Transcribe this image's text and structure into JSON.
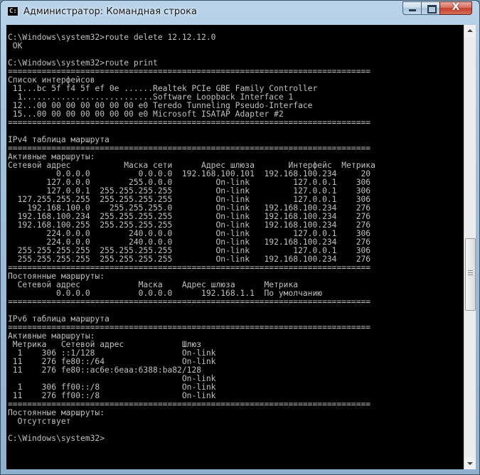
{
  "window": {
    "title": "Администратор: Командная строка",
    "icon_label": "C:\\",
    "close_symbol": "X"
  },
  "console": {
    "lines": [
      "C:\\Windows\\system32>route delete 12.12.12.0",
      " OK",
      "",
      "C:\\Windows\\system32>route print",
      "===========================================================================",
      "Список интерфейсов",
      " 11...bc 5f f4 5f ef 0e ......Realtek PCIe GBE Family Controller",
      "  1...........................Software Loopback Interface 1",
      " 12...00 00 00 00 00 00 00 e0 Teredo Tunneling Pseudo-Interface",
      " 15...00 00 00 00 00 00 00 e0 Microsoft ISATAP Adapter #2",
      "===========================================================================",
      "",
      "IPv4 таблица маршрута",
      "===========================================================================",
      "Активные маршруты:",
      "Сетевой адрес           Маска сети      Адрес шлюза       Интерфейс  Метрика",
      "          0.0.0.0          0.0.0.0  192.168.100.101  192.168.100.234     20",
      "        127.0.0.0        255.0.0.0         On-link         127.0.0.1    306",
      "        127.0.0.1  255.255.255.255         On-link         127.0.0.1    306",
      "  127.255.255.255  255.255.255.255         On-link         127.0.0.1    306",
      "    192.168.100.0    255.255.255.0         On-link   192.168.100.234    276",
      "  192.168.100.234  255.255.255.255         On-link   192.168.100.234    276",
      "  192.168.100.255  255.255.255.255         On-link   192.168.100.234    276",
      "        224.0.0.0        240.0.0.0         On-link         127.0.0.1    306",
      "        224.0.0.0        240.0.0.0         On-link   192.168.100.234    276",
      "  255.255.255.255  255.255.255.255         On-link         127.0.0.1    306",
      "  255.255.255.255  255.255.255.255         On-link   192.168.100.234    276",
      "===========================================================================",
      "Постоянные маршруты:",
      "  Сетевой адрес            Маска    Адрес шлюза      Метрика",
      "          0.0.0.0          0.0.0.0      192.168.1.1  По умолчанию",
      "===========================================================================",
      "",
      "IPv6 таблица маршрута",
      "===========================================================================",
      "Активные маршруты:",
      " Метрика   Сетевой адрес            Шлюз",
      "  1    306 ::1/128                  On-link",
      " 11    276 fe80::/64                On-link",
      " 11    276 fe80::ac6e:6eaa:6388:ba82/128",
      "                                    On-link",
      "  1    306 ff00::/8                 On-link",
      " 11    276 ff00::/8                 On-link",
      "===========================================================================",
      "Постоянные маршруты:",
      "  Отсутствует",
      "",
      "C:\\Windows\\system32>"
    ]
  }
}
